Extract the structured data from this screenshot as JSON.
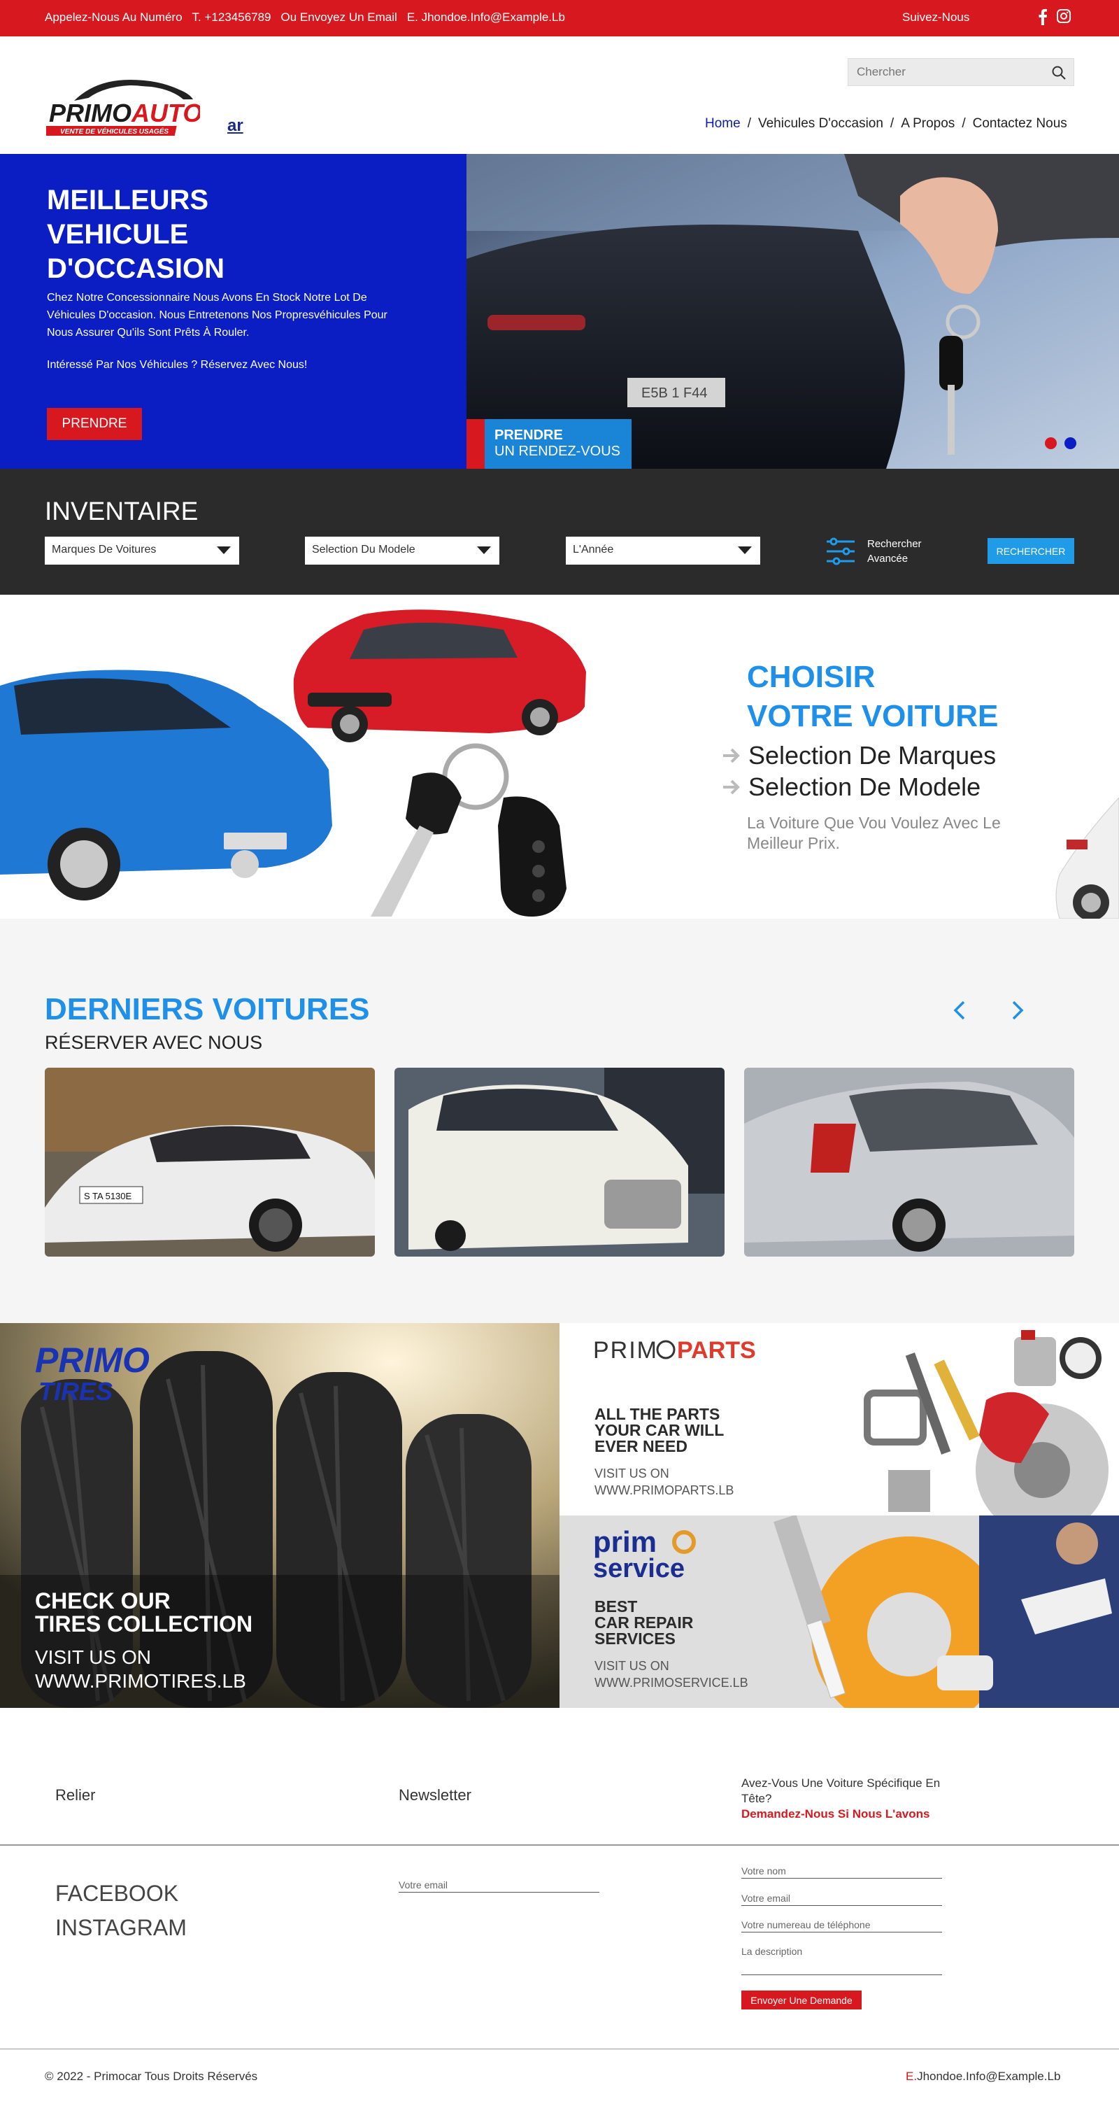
{
  "topbar": {
    "call_label": "Appelez-Nous Au Numéro",
    "phone": "T. +123456789",
    "email_label": "Ou Envoyez Un Email",
    "email": "E. Jhondoe.Info@Example.Lb",
    "follow": "Suivez-Nous",
    "social_icons": [
      "facebook-icon",
      "instagram-icon"
    ]
  },
  "header": {
    "search_placeholder": "Chercher",
    "logo_main": "PRIMOAUTO",
    "logo_tagline": "VENTE DE VÉHICULES USAGÉS",
    "lang_link": "ar",
    "nav": [
      "Home",
      "Vehicules D'occasion",
      "A Propos",
      "Contactez Nous"
    ]
  },
  "hero": {
    "title": "MEILLEURS VEHICULE D'OCCASION",
    "text": "Chez Notre Concessionnaire Nous Avons En Stock Notre Lot De Véhicules D'occasion. Nous Entretenons Nos Propresvéhicules Pour Nous Assurer Qu'ils Sont Prêts À Rouler.",
    "text2": "Intéressé Par Nos Véhicules ? Réservez Avec Nous!",
    "button": "PRENDRE",
    "rdv_line1": "PRENDRE",
    "rdv_line2": "UN RENDEZ-VOUS",
    "plate": "E5B 1 F44"
  },
  "inventory": {
    "title": "INVENTAIRE",
    "selects": [
      "Marques De Voitures",
      "Selection Du Modele",
      "L'Année"
    ],
    "advanced_line1": "Rechercher",
    "advanced_line2": "Avancée",
    "search_button": "RECHERCHER"
  },
  "choose": {
    "title_line1": "CHOISIR",
    "title_line2": "VOTRE VOITURE",
    "items": [
      "Selection De Marques",
      "Selection De Modele"
    ],
    "subtitle": "La Voiture Que Vou Voulez Avec Le Meilleur Prix."
  },
  "latest": {
    "title": "DERNIERS VOITURES",
    "subtitle": "RÉSERVER AVEC NOUS",
    "plate": "S TA 5130E"
  },
  "promos": {
    "tires": {
      "logo_line1": "PRIMO",
      "logo_line2": "TIRES",
      "headline1": "CHECK OUR",
      "headline2": "TIRES COLLECTION",
      "visit1": "VISIT US ON",
      "visit2": "WWW.PRIMOTIRES.LB"
    },
    "parts": {
      "logo_a": "PRIM",
      "logo_b": "PARTS",
      "headline": [
        "ALL THE PARTS",
        "YOUR CAR WILL",
        "EVER NEED"
      ],
      "visit1": "VISIT US ON",
      "visit2": "WWW.PRIMOPARTS.LB"
    },
    "service": {
      "logo_line1": "prim",
      "logo_line2": "service",
      "headline": [
        "BEST",
        "CAR REPAIR",
        "SERVICES"
      ],
      "visit1": "VISIT US ON",
      "visit2": "WWW.PRIMOSERVICE.LB"
    }
  },
  "footer": {
    "col1_title": "Relier",
    "col1_links": [
      "FACEBOOK",
      "INSTAGRAM"
    ],
    "col2_title": "Newsletter",
    "col2_placeholder": "Votre email",
    "col3_title": "Avez-Vous Une Voiture Spécifique En Tête?",
    "col3_cta": "Demandez-Nous Si Nous L'avons",
    "form": [
      "Votre nom",
      "Votre email",
      "Votre numereau de téléphone",
      "La description"
    ],
    "send_button": "Envoyer Une Demande",
    "copyright": "© 2022 - Primocar Tous Droits Réservés",
    "email_prefix": "E.",
    "email": "Jhondoe.Info@Example.Lb"
  },
  "colors": {
    "brand_red": "#d7191f",
    "brand_blue": "#0a1ec3",
    "accent_blue": "#1f90ea",
    "dark": "#2b2b2b"
  }
}
